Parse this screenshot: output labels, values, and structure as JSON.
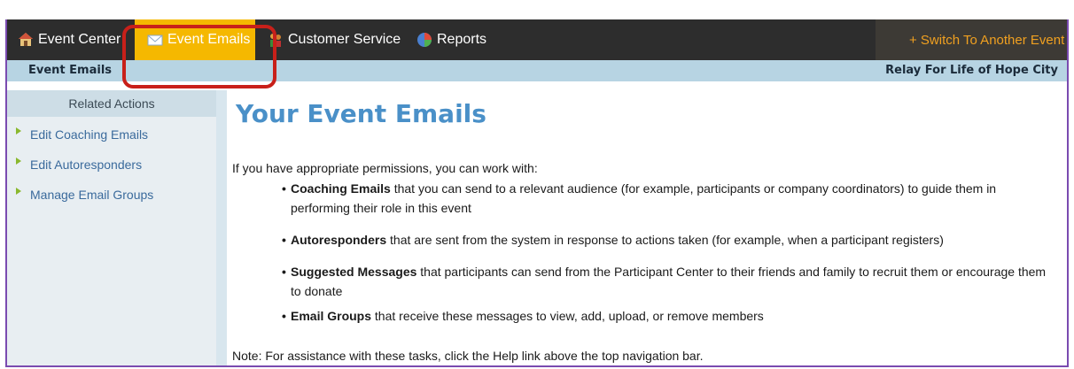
{
  "nav": {
    "event_center": "Event Center",
    "event_emails": "Event Emails",
    "customer_service": "Customer Service",
    "reports": "Reports",
    "switch_event": "+ Switch To Another Event",
    "icons": {
      "event_center": "home-icon",
      "event_emails": "envelope-icon",
      "customer_service": "people-icon",
      "reports": "chart-icon"
    }
  },
  "subbar": {
    "section": "Event Emails",
    "event_name": "Relay For Life of Hope City"
  },
  "sidebar": {
    "heading": "Related Actions",
    "items": [
      {
        "label": "Edit Coaching Emails"
      },
      {
        "label": "Edit Autoresponders"
      },
      {
        "label": "Manage Email Groups"
      }
    ]
  },
  "main": {
    "title": "Your Event Emails",
    "intro": "If you have appropriate permissions, you can work with:",
    "bullets": [
      {
        "term": "Coaching Emails",
        "text": " that you can send to a relevant audience (for example, participants or company coordinators) to guide them in performing their role in this event"
      },
      {
        "term": "Autoresponders",
        "text": " that are sent from the system in response to actions taken (for example, when a participant registers)"
      },
      {
        "term": "Suggested Messages",
        "text": " that participants can send from the Participant Center to their friends and family to recruit them or encourage them to donate"
      },
      {
        "term": "Email Groups",
        "text": " that receive these messages to view, add, upload, or remove members"
      }
    ],
    "note": "Note: For assistance with these tasks, click the Help link above the top navigation bar."
  },
  "colors": {
    "nav_bg": "#2d2d2d",
    "active_tab": "#f5b800",
    "switch_text": "#f0a020",
    "highlight_ring": "#c8201a",
    "subbar_bg": "#b7d4e3",
    "title": "#4a90c8",
    "link": "#3a6a9c"
  }
}
